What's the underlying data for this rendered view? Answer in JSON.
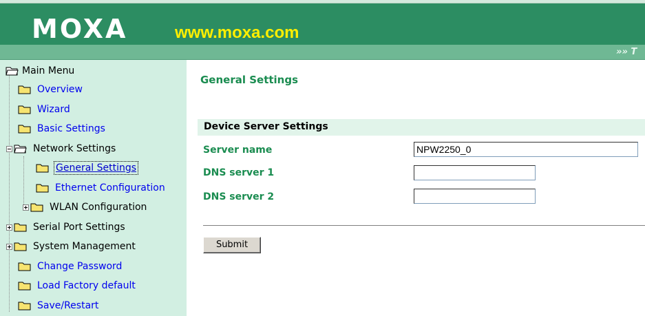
{
  "header": {
    "logo": "MOXA",
    "site": "www.moxa.com",
    "ticker": "»» T"
  },
  "sidebar": {
    "root": "Main Menu",
    "items": [
      {
        "label": "Overview"
      },
      {
        "label": "Wizard"
      },
      {
        "label": "Basic Settings"
      },
      {
        "label": "Network Settings"
      },
      {
        "label": "General Settings"
      },
      {
        "label": "Ethernet Configuration"
      },
      {
        "label": "WLAN Configuration"
      },
      {
        "label": "Serial Port Settings"
      },
      {
        "label": "System Management"
      },
      {
        "label": "Change Password"
      },
      {
        "label": "Load Factory default"
      },
      {
        "label": "Save/Restart"
      }
    ]
  },
  "main": {
    "title": "General Settings",
    "section": "Device Server Settings",
    "fields": [
      {
        "label": "Server name",
        "value": "NPW2250_0"
      },
      {
        "label": "DNS server 1",
        "value": ""
      },
      {
        "label": "DNS server 2",
        "value": ""
      }
    ],
    "submit_label": "Submit"
  },
  "colors": {
    "banner": "#2c8d62",
    "bar": "#6fb894",
    "sidebar": "#d2efe2",
    "accent_green": "#1a8c50",
    "link": "#0000ee",
    "site_text": "#ffef00"
  }
}
